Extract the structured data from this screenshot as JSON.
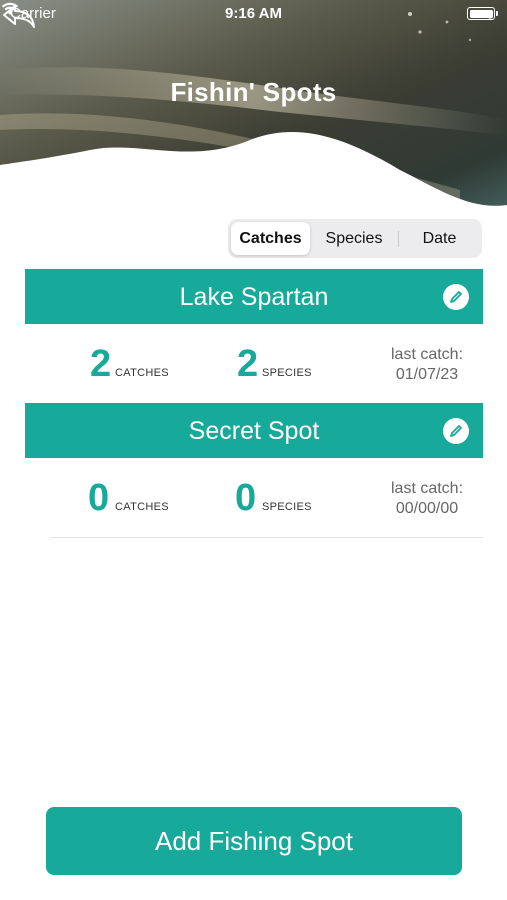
{
  "status_bar": {
    "carrier": "Carrier",
    "time": "9:16 AM"
  },
  "header": {
    "title": "Fishin' Spots"
  },
  "sort_control": {
    "options": [
      "Catches",
      "Species",
      "Date"
    ],
    "selected": "Catches"
  },
  "spots": [
    {
      "name": "Lake Spartan",
      "catches": "2",
      "catches_label": "CATCHES",
      "species": "2",
      "species_label": "SPECIES",
      "last_catch_label": "last catch:",
      "last_catch_date": "01/07/23"
    },
    {
      "name": "Secret Spot",
      "catches": "0",
      "catches_label": "CATCHES",
      "species": "0",
      "species_label": "SPECIES",
      "last_catch_label": "last catch:",
      "last_catch_date": "00/00/00"
    }
  ],
  "add_button": {
    "label": "Add Fishing Spot"
  },
  "colors": {
    "accent": "#17a99a",
    "segment_bg": "#ececee"
  },
  "icons": {
    "back": "reply-arrow-icon",
    "edit": "pencil-icon",
    "wifi": "wifi-icon",
    "battery": "battery-icon"
  }
}
